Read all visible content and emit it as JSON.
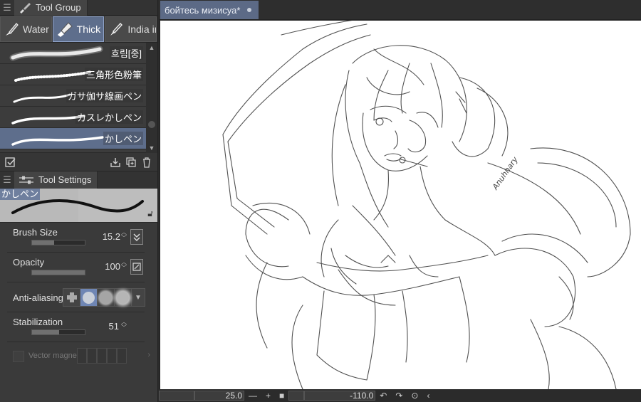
{
  "tool_group": {
    "tab_label": "Tool Group",
    "subtools": [
      {
        "label": "Water",
        "active": false
      },
      {
        "label": "Thick",
        "active": true
      },
      {
        "label": "India ink",
        "active": false
      }
    ]
  },
  "brush_list": {
    "items": [
      {
        "name": "흐림[중]",
        "selected": false
      },
      {
        "name": "三角形色粉筆",
        "selected": false
      },
      {
        "name": "ガサ伽サ線画ペン",
        "selected": false
      },
      {
        "name": "カスレかしペン",
        "selected": false
      },
      {
        "name": "かしペン",
        "selected": true
      }
    ]
  },
  "tool_settings": {
    "tab_label": "Tool Settings",
    "preview_name": "かしペン",
    "brush_size": {
      "label": "Brush Size",
      "value": "15.2",
      "fraction": 0.42
    },
    "opacity": {
      "label": "Opacity",
      "value": "100",
      "fraction": 1.0
    },
    "anti_aliasing": {
      "label": "Anti-aliasing",
      "selected_index": 1
    },
    "stabilization": {
      "label": "Stabilization",
      "value": "51",
      "fraction": 0.51
    },
    "vector_magnet": {
      "label": "Vector magnet"
    }
  },
  "canvas": {
    "tab_title": "бойтесь мизисуа*",
    "signature": "Anuhhary"
  },
  "status_bar": {
    "zoom": "25.0",
    "rotation": "-110.0"
  },
  "colors": {
    "accent": "#5e6e8c",
    "panel_bg": "#3a3a3a",
    "canvas_bg": "#ffffff"
  }
}
